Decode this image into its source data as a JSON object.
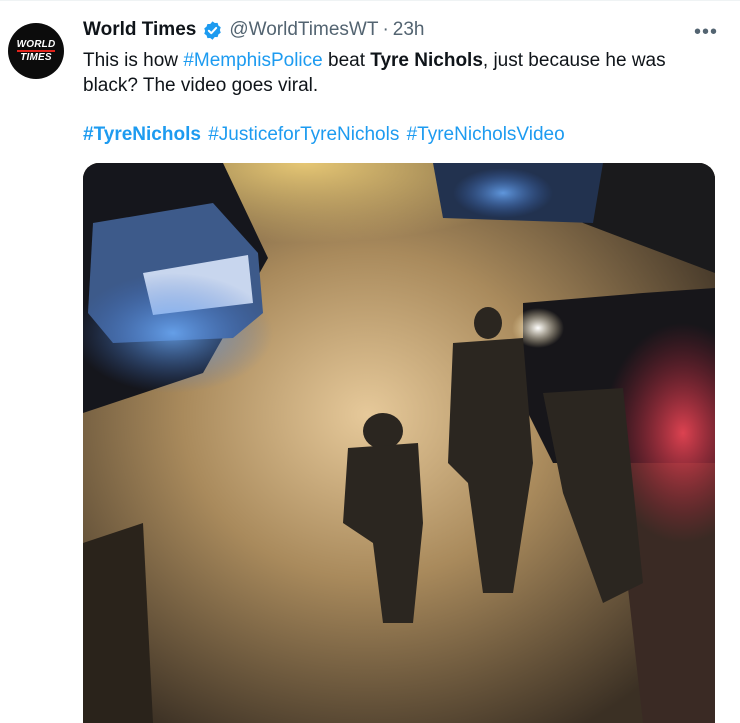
{
  "tweet": {
    "author_name": "World Times",
    "author_handle": "@WorldTimesWT",
    "separator": "·",
    "time": "23h",
    "more_label": "•••",
    "avatar": {
      "line1": "WORLD",
      "line2": "TIMES"
    },
    "text": {
      "part1": "This is how ",
      "hashtag1": "#MemphisPolice",
      "part2": " beat ",
      "bold_name": "Tyre Nichols",
      "part3": ", just because he was black? The video goes viral."
    },
    "hashtags": [
      "#TyreNichols",
      "#JusticeforTyreNichols",
      "#TyreNicholsVideo"
    ],
    "colors": {
      "link": "#1d9bf0",
      "verified": "#1d9bf0",
      "secondary": "#536471"
    }
  }
}
